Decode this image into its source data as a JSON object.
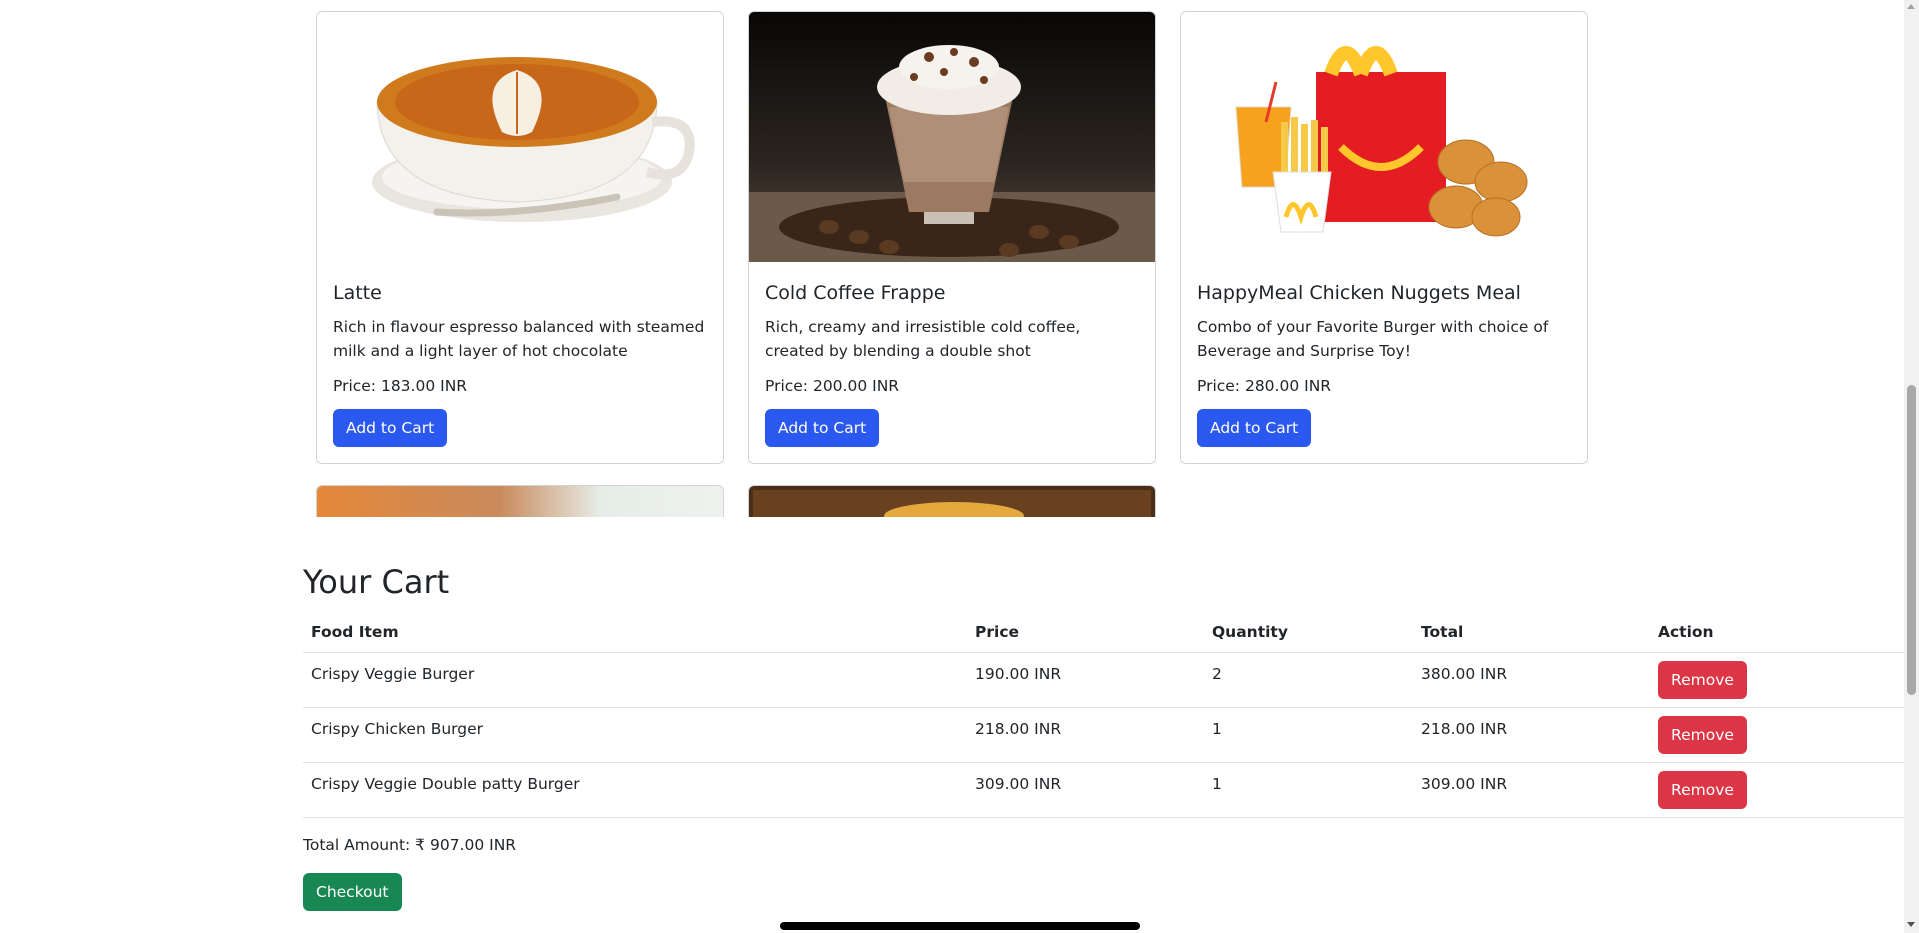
{
  "products": [
    {
      "name": "Latte",
      "description": "Rich in flavour espresso balanced with steamed milk and a light layer of hot chocolate",
      "price": "Price: 183.00 INR",
      "button_label": "Add to Cart"
    },
    {
      "name": "Cold Coffee Frappe",
      "description": "Rich, creamy and irresistible cold coffee, created by blending a double shot",
      "price": "Price: 200.00 INR",
      "button_label": "Add to Cart"
    },
    {
      "name": "HappyMeal Chicken Nuggets Meal",
      "description": "Combo of your Favorite Burger with choice of Beverage and Surprise Toy!",
      "price": "Price: 280.00 INR",
      "button_label": "Add to Cart"
    }
  ],
  "cart": {
    "title": "Your Cart",
    "headers": [
      "Food Item",
      "Price",
      "Quantity",
      "Total",
      "Action"
    ],
    "rows": [
      {
        "item": "Crispy Veggie Burger",
        "price": "190.00 INR",
        "quantity": "2",
        "total": "380.00 INR",
        "action": "Remove"
      },
      {
        "item": "Crispy Chicken Burger",
        "price": "218.00 INR",
        "quantity": "1",
        "total": "218.00 INR",
        "action": "Remove"
      },
      {
        "item": "Crispy Veggie Double patty Burger",
        "price": "309.00 INR",
        "quantity": "1",
        "total": "309.00 INR",
        "action": "Remove"
      }
    ],
    "total_amount": "Total Amount: ₹ 907.00 INR",
    "checkout_label": "Checkout"
  },
  "colors": {
    "primary": "#2b59f0",
    "danger": "#dc3545",
    "success": "#198754"
  }
}
